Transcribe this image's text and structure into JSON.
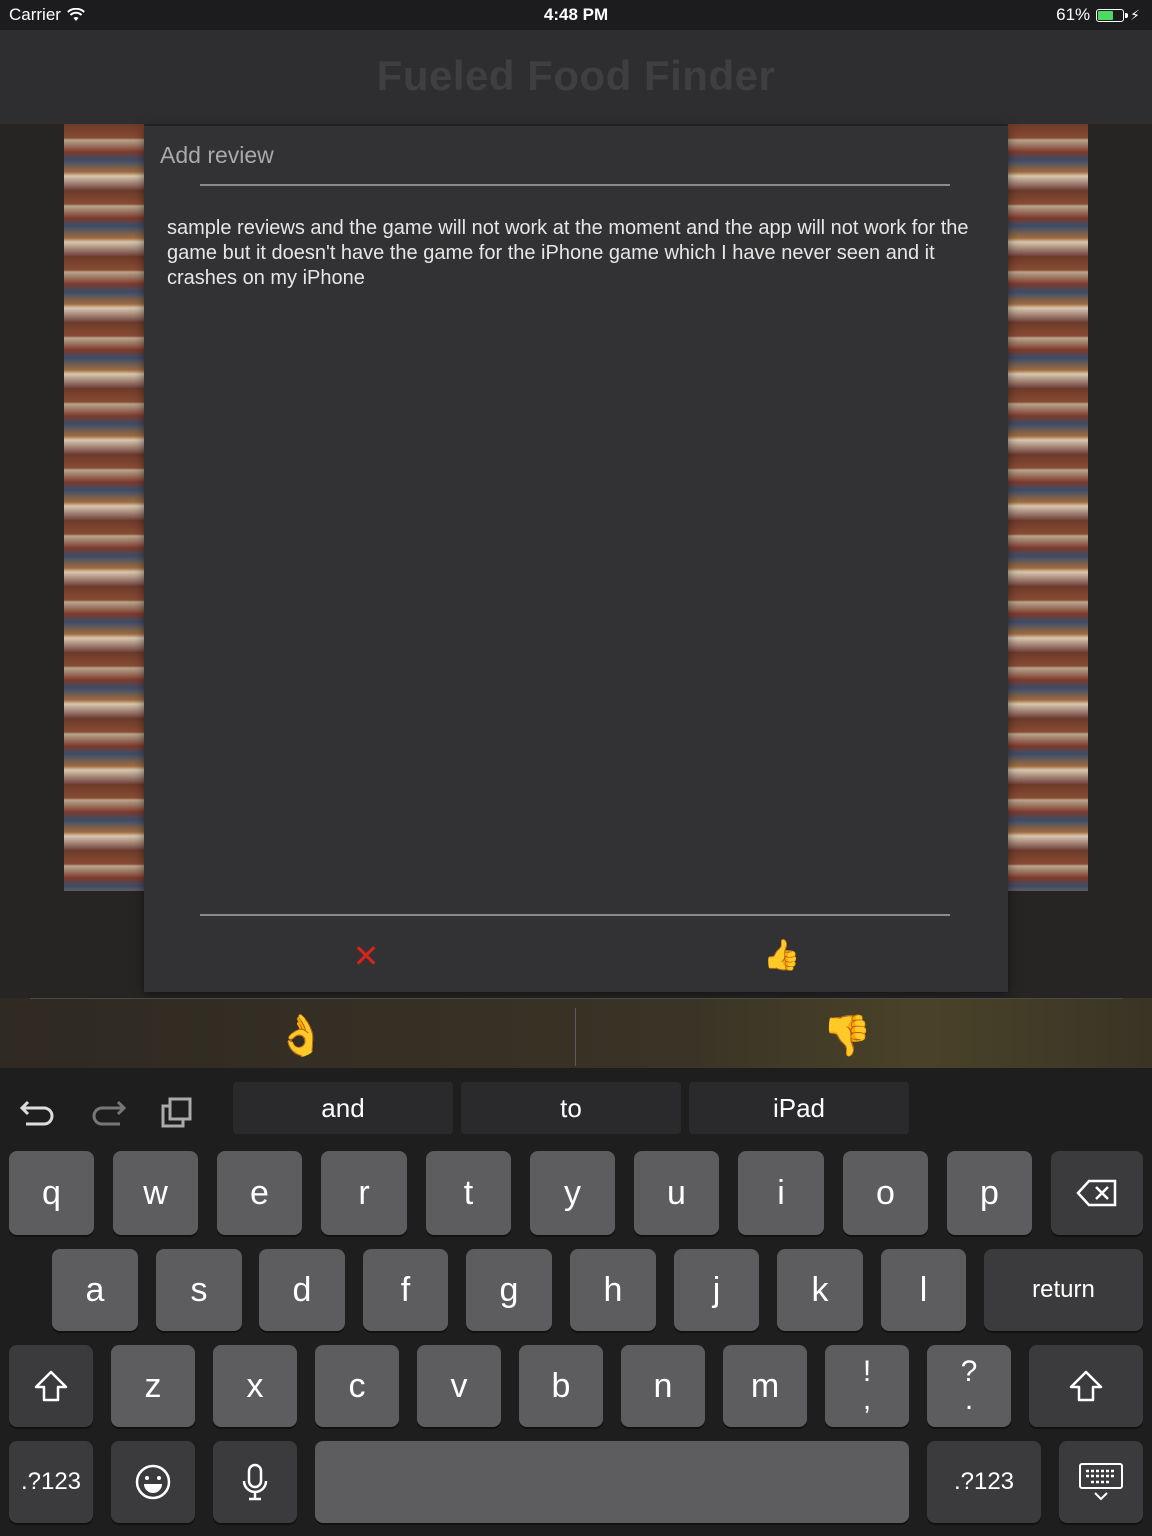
{
  "status_bar": {
    "carrier": "Carrier",
    "time": "4:48 PM",
    "battery_percent": "61%",
    "battery_level": 0.61
  },
  "app": {
    "title": "Fueled Food Finder"
  },
  "dialog": {
    "title": "Add review",
    "review_text": "sample reviews and the game will not work at the moment and the app will not work for the game but it doesn't have the game for the iPhone game which I have never seen and it crashes on my iPhone",
    "cancel_icon": "close-icon",
    "submit_icon": "thumbs-up-icon"
  },
  "rating": {
    "good_icon": "ok-hand-icon",
    "bad_icon": "thumbs-down-icon"
  },
  "keyboard": {
    "shortcuts": [
      "undo-icon",
      "redo-icon",
      "paste-icon"
    ],
    "suggestions": [
      "and",
      "to",
      "iPad"
    ],
    "row1": [
      "q",
      "w",
      "e",
      "r",
      "t",
      "y",
      "u",
      "i",
      "o",
      "p"
    ],
    "row2": [
      "a",
      "s",
      "d",
      "f",
      "g",
      "h",
      "j",
      "k",
      "l"
    ],
    "return_label": "return",
    "row3": [
      "z",
      "x",
      "c",
      "v",
      "b",
      "n",
      "m"
    ],
    "punct1_top": "!",
    "punct1_bottom": ",",
    "punct2_top": "?",
    "punct2_bottom": ".",
    "numbers_label": ".?123"
  }
}
